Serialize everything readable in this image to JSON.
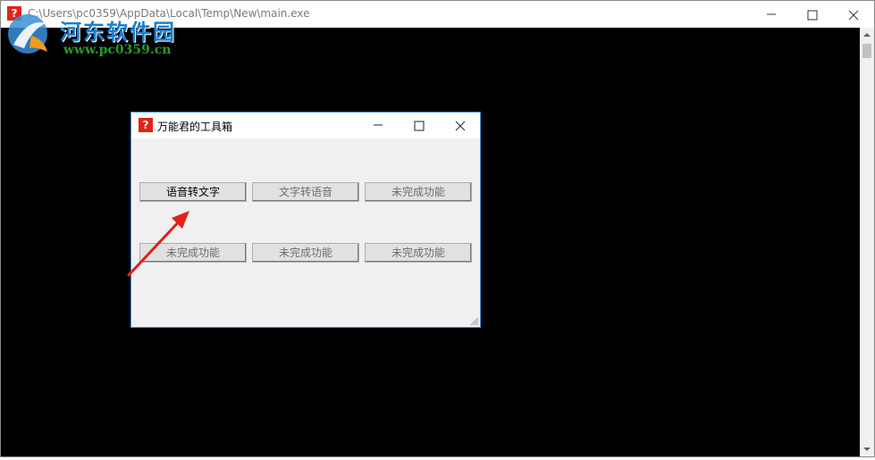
{
  "outer_window": {
    "title": "C:\\Users\\pc0359\\AppData\\Local\\Temp\\New\\main.exe",
    "icon": "question-mark-icon",
    "controls": {
      "minimize": "minimize-icon",
      "maximize": "maximize-icon",
      "close": "close-icon"
    }
  },
  "watermark": {
    "name": "河东软件园",
    "url": "www.pc0359.cn"
  },
  "dialog": {
    "title": "万能君的工具箱",
    "icon": "question-mark-icon",
    "buttons": [
      {
        "label": "语音转文字",
        "enabled": true
      },
      {
        "label": "文字转语音",
        "enabled": false
      },
      {
        "label": "未完成功能",
        "enabled": false
      },
      {
        "label": "未完成功能",
        "enabled": false
      },
      {
        "label": "未完成功能",
        "enabled": false
      },
      {
        "label": "未完成功能",
        "enabled": false
      }
    ]
  },
  "colors": {
    "console_background": "#000000",
    "dialog_background": "#f0f0f0",
    "dialog_border": "#4a90d9",
    "annotation_arrow": "#e0201b",
    "icon_red": "#e2231a"
  }
}
